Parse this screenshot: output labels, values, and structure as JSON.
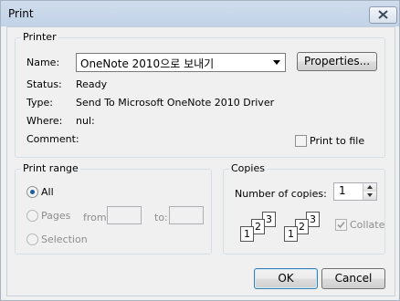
{
  "window": {
    "title": "Print"
  },
  "printer": {
    "group_label": "Printer",
    "name_label": "Name:",
    "name_value": "OneNote 2010으로 보내기",
    "properties_label": "Properties...",
    "status_label": "Status:",
    "status_value": "Ready",
    "type_label": "Type:",
    "type_value": "Send To Microsoft OneNote 2010 Driver",
    "where_label": "Where:",
    "where_value": "nul:",
    "comment_label": "Comment:",
    "print_to_file_label": "Print to file"
  },
  "print_range": {
    "group_label": "Print range",
    "all_label": "All",
    "pages_label": "Pages",
    "from_label": "from:",
    "to_label": "to:",
    "selection_label": "Selection"
  },
  "copies": {
    "group_label": "Copies",
    "number_label": "Number of copies:",
    "number_value": "1",
    "collate_label": "Collate",
    "collate_pages": [
      "1",
      "2",
      "3"
    ]
  },
  "buttons": {
    "ok": "OK",
    "cancel": "Cancel"
  }
}
